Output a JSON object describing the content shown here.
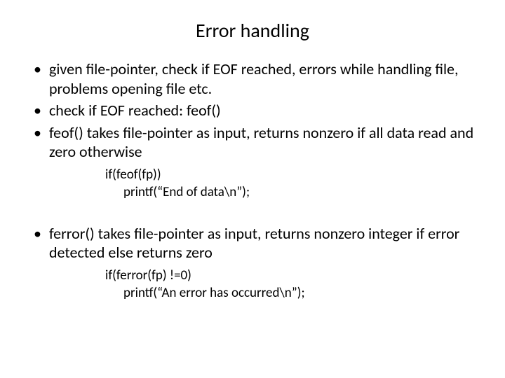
{
  "title": "Error handling",
  "bullets_a": [
    "given file-pointer, check if EOF reached, errors while handling file, problems opening file etc.",
    "check if EOF reached: feof()",
    "feof() takes file-pointer as input, returns nonzero if all data read and zero otherwise"
  ],
  "code_a": {
    "line1": "if(feof(fp))",
    "line2": "printf(“End of data\\n”);"
  },
  "bullets_b": [
    "ferror() takes file-pointer as input, returns nonzero integer if error detected  else returns zero"
  ],
  "code_b": {
    "line1": "if(ferror(fp) !=0)",
    "line2": "printf(“An error has occurred\\n”);"
  }
}
